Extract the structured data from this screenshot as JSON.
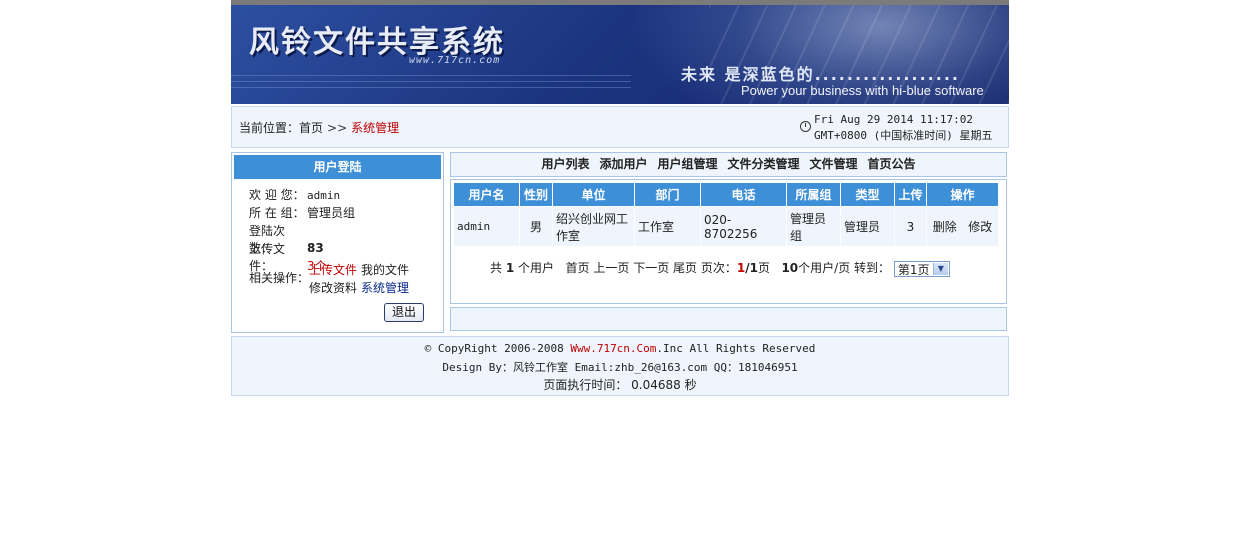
{
  "banner": {
    "title": "风铃文件共享系统",
    "url": "www.717cn.com",
    "slogan_cn": "未来 是深蓝色的..................",
    "slogan_en": "Power your business with hi-blue software"
  },
  "location": {
    "prefix": "当前位置：",
    "home": "首页",
    "separator": ">>",
    "current": "系统管理",
    "date_line1": "Fri Aug 29 2014 11:17:02",
    "date_line2": "GMT+0800 (中国标准时间) 星期五"
  },
  "login_panel": {
    "header": "用户登陆",
    "welcome_label": "欢 迎 您：",
    "welcome_value": "admin",
    "group_label": "所 在 组：",
    "group_value": "管理员组",
    "login_count_label": "登陆次数：",
    "login_count_value": "83",
    "upload_label": "上传文件：",
    "upload_value": "3个",
    "ops_label": "相关操作：",
    "ops": {
      "upload": "上传文件",
      "my_files": "我的文件",
      "edit_profile": "修改资料",
      "system_admin": "系统管理"
    },
    "logout": "退出"
  },
  "nav": {
    "items": [
      "用户列表",
      "添加用户",
      "用户组管理",
      "文件分类管理",
      "文件管理",
      "首页公告"
    ]
  },
  "table": {
    "headers": [
      "用户名",
      "性别",
      "单位",
      "部门",
      "电话",
      "所属组",
      "类型",
      "上传",
      "操作"
    ],
    "rows": [
      {
        "username": "admin",
        "gender": "男",
        "company": "绍兴创业网工作室",
        "department": "工作室",
        "phone": "020-8702256",
        "group": "管理员组",
        "type": "管理员",
        "uploads": "3",
        "delete": "删除",
        "edit": "修改"
      }
    ]
  },
  "pager": {
    "total_prefix": "共",
    "total": "1",
    "total_suffix": "个用户",
    "first": "首页",
    "prev": "上一页",
    "next": "下一页",
    "last": "尾页",
    "page_label": "页次：",
    "page_current": "1",
    "page_total": "/1",
    "page_suffix": "页",
    "per_page": "10",
    "per_page_suffix": "个用户/页",
    "goto_label": "转到：",
    "goto_value": "第1页"
  },
  "footer": {
    "copyright_prefix": "© CopyRight 2006-2008 ",
    "copyright_site": "Www.717cn.Com",
    "copyright_suffix": ".Inc All Rights Reserved",
    "design": "Design By：风铃工作室   Email:zhb_26@163.com   QQ：181046951",
    "exec_time": "页面执行时间： 0.04688 秒"
  }
}
